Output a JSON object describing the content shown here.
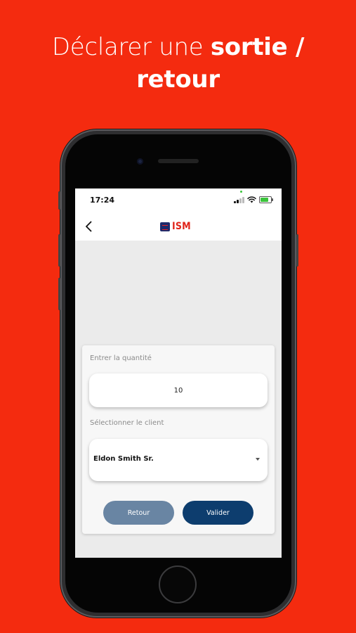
{
  "headline": {
    "line1_prefix": "Déclarer une",
    "line1_bold": "sortie /",
    "line2_bold": "retour"
  },
  "status_bar": {
    "time": "17:24"
  },
  "nav": {
    "back_icon": "chevron-left-icon",
    "logo_text": "ISM"
  },
  "form": {
    "quantity_label": "Entrer la quantité",
    "quantity_value": "10",
    "client_label": "Sélectionner le client",
    "client_value": "Eldon Smith Sr."
  },
  "actions": {
    "retour_label": "Retour",
    "valider_label": "Valider"
  },
  "colors": {
    "background": "#f42b0f",
    "retour_button": "#6985a3",
    "valider_button": "#0d3d6e",
    "logo_red": "#e0241a",
    "logo_navy": "#1d2a6b"
  }
}
